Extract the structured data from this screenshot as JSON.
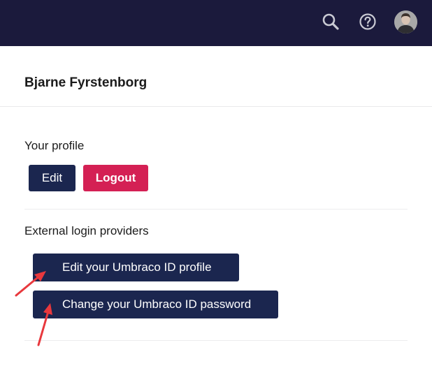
{
  "topbar": {
    "background": "#1b1a3c",
    "icons": [
      "search-icon",
      "help-icon",
      "user-avatar"
    ]
  },
  "user": {
    "name": "Bjarne Fyrstenborg"
  },
  "profile_section": {
    "title": "Your profile",
    "edit_label": "Edit",
    "logout_label": "Logout"
  },
  "external_section": {
    "title": "External login providers",
    "edit_id_label": "Edit your Umbraco ID profile",
    "change_password_label": "Change your Umbraco ID password"
  },
  "colors": {
    "navy": "#1b264f",
    "pink": "#d42054",
    "annotation_arrow": "#e8383d"
  }
}
